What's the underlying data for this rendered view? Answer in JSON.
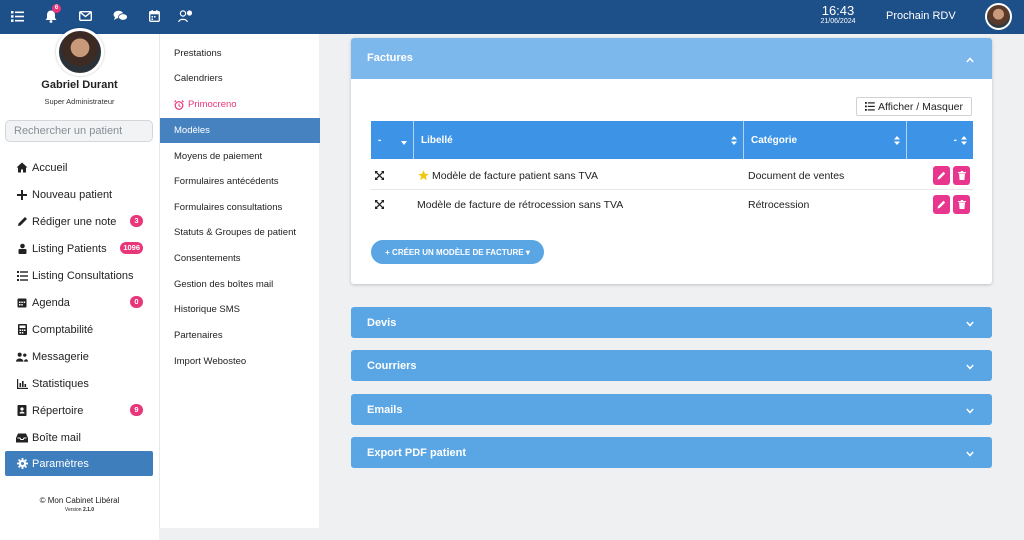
{
  "topbar": {
    "notification_count": "6",
    "time": "16:43",
    "date": "21/06/2024",
    "next_rdv_label": "Prochain RDV",
    "icons": [
      "list-icon",
      "bell-icon",
      "mail-icon",
      "chat-icon",
      "calendar-icon",
      "users-icon"
    ]
  },
  "user": {
    "name": "Gabriel Durant",
    "role": "Super Administrateur"
  },
  "search": {
    "placeholder": "Rechercher un patient"
  },
  "nav": [
    {
      "label": "Accueil",
      "icon": "home-icon"
    },
    {
      "label": "Nouveau patient",
      "icon": "plus-icon"
    },
    {
      "label": "Rédiger une note",
      "icon": "pencil-icon",
      "badge": "3"
    },
    {
      "label": "Listing Patients",
      "icon": "id-card-icon",
      "badge": "1096"
    },
    {
      "label": "Listing Consultations",
      "icon": "list-icon"
    },
    {
      "label": "Agenda",
      "icon": "calendar-icon",
      "badge": "0"
    },
    {
      "label": "Comptabilité",
      "icon": "calculator-icon"
    },
    {
      "label": "Messagerie",
      "icon": "users-icon"
    },
    {
      "label": "Statistiques",
      "icon": "bar-chart-icon"
    },
    {
      "label": "Répertoire",
      "icon": "address-book-icon",
      "badge": "9"
    },
    {
      "label": "Boîte mail",
      "icon": "inbox-icon"
    },
    {
      "label": "Paramètres",
      "icon": "gear-icon",
      "active": true
    }
  ],
  "footer": {
    "copyright": "© Mon Cabinet Libéral",
    "version_label": "Version",
    "version": "2.1.0"
  },
  "submenu": [
    {
      "label": "Prestations"
    },
    {
      "label": "Calendriers"
    },
    {
      "label": "Primocreno",
      "highlight": true
    },
    {
      "label": "Modèles",
      "active": true
    },
    {
      "label": "Moyens de paiement"
    },
    {
      "label": "Formulaires antécédents"
    },
    {
      "label": "Formulaires consultations"
    },
    {
      "label": "Statuts & Groupes de patient"
    },
    {
      "label": "Consentements"
    },
    {
      "label": "Gestion des boîtes mail"
    },
    {
      "label": "Historique SMS"
    },
    {
      "label": "Partenaires"
    },
    {
      "label": "Import Webosteo"
    }
  ],
  "factures": {
    "title": "Factures",
    "toggle_label": "Afficher / Masquer",
    "columns": [
      "-",
      "Libellé",
      "Catégorie",
      "-"
    ],
    "rows": [
      {
        "libelle": "Modèle de facture patient sans TVA",
        "categorie": "Document de ventes",
        "starred": true
      },
      {
        "libelle": "Modèle de facture de rétrocession sans TVA",
        "categorie": "Rétrocession",
        "starred": false
      }
    ],
    "create_label": "+ CRÉER UN MODÈLE DE FACTURE ▾"
  },
  "panels": [
    "Devis",
    "Courriers",
    "Emails",
    "Export PDF patient"
  ],
  "colors": {
    "topbar": "#1d4f88",
    "accent": "#3f7ebd",
    "panel": "#5aa6e5",
    "badge": "#e8367a"
  }
}
